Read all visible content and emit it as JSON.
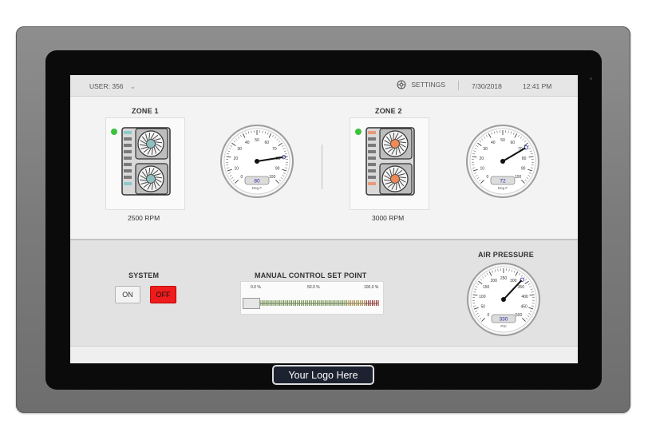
{
  "topbar": {
    "user_label": "USER: 356",
    "settings_label": "SETTINGS",
    "date": "7/30/2018",
    "time": "12:41 PM"
  },
  "zones": [
    {
      "title": "ZONE 1",
      "rpm": "2500 RPM",
      "status_color": "#3cc23c",
      "fan_hub_color": "#8fbfbf",
      "gauge_value": "80",
      "gauge_unit": "Deg F",
      "gauge_ticks": [
        "0",
        "10",
        "20",
        "30",
        "40",
        "50",
        "60",
        "70",
        "80",
        "90",
        "100"
      ],
      "needle_fraction": 0.8
    },
    {
      "title": "ZONE 2",
      "rpm": "3000 RPM",
      "status_color": "#3cc23c",
      "fan_hub_color": "#ef8a55",
      "gauge_value": "72",
      "gauge_unit": "Deg F",
      "gauge_ticks": [
        "0",
        "10",
        "20",
        "30",
        "40",
        "50",
        "60",
        "70",
        "80",
        "90",
        "100"
      ],
      "needle_fraction": 0.72
    }
  ],
  "system": {
    "title": "SYSTEM",
    "on_label": "ON",
    "off_label": "OFF",
    "state": "OFF"
  },
  "manual_control": {
    "title": "MANUAL CONTROL SET POINT",
    "min_label": "0.0 %",
    "mid_label": "50.0 %",
    "max_label": "100.0 %",
    "value_fraction": 0.0
  },
  "air_pressure": {
    "title": "AIR PRESSURE",
    "gauge_value": "330",
    "gauge_unit": "PSI",
    "gauge_ticks": [
      "0",
      "50",
      "100",
      "150",
      "200",
      "250",
      "300",
      "350",
      "400",
      "450",
      "500"
    ],
    "needle_fraction": 0.66
  },
  "logo": {
    "text": "Your Logo Here"
  },
  "colors": {
    "accent_blue": "#3a3aa8",
    "off_red": "#ee1c1c",
    "status_green": "#3cc23c"
  }
}
